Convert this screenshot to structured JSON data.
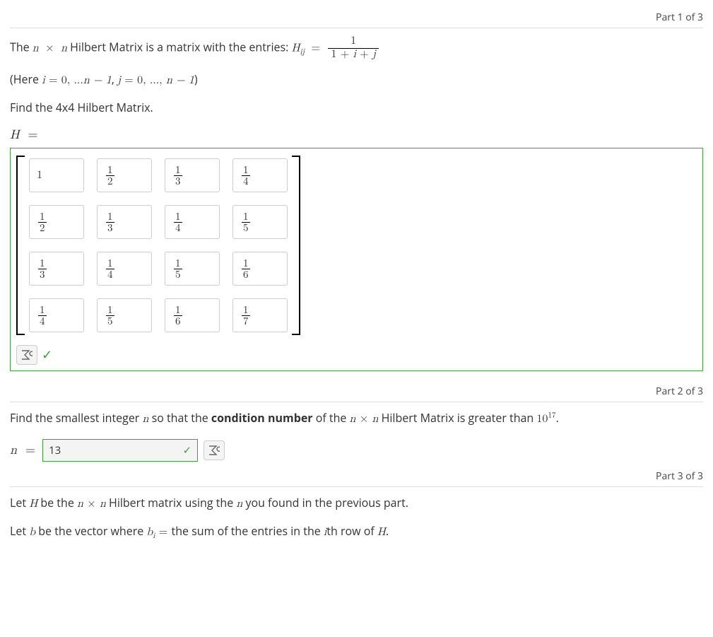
{
  "parts": {
    "p1_label": "Part 1 of 3",
    "p2_label": "Part 2 of 3",
    "p3_label": "Part 3 of 3"
  },
  "part1": {
    "intro_pre": "The ",
    "intro_mid": " Hilbert Matrix is a matrix with the entries: ",
    "dim_n": "n",
    "times": "×",
    "Hij": "H",
    "Hij_sub": "ij",
    "eq": "=",
    "frac_num": "1",
    "frac_den_prefix": "1 + ",
    "frac_den_i": "i",
    "frac_den_plus": " + ",
    "frac_den_j": "j",
    "range_open": "(Here ",
    "range_i": "i",
    "range_eq": " = 0, ...",
    "range_nm1": "n − 1",
    "range_comma": ",  ",
    "range_j": "j",
    "range_jeq": " = 0, ..., ",
    "range_close": ")",
    "find_text": "Find the 4x4 Hilbert Matrix.",
    "Hlabel": "H",
    "Heq": "=",
    "matrix": [
      [
        "1",
        "1/2",
        "1/3",
        "1/4"
      ],
      [
        "1/2",
        "1/3",
        "1/4",
        "1/5"
      ],
      [
        "1/3",
        "1/4",
        "1/5",
        "1/6"
      ],
      [
        "1/4",
        "1/5",
        "1/6",
        "1/7"
      ]
    ]
  },
  "part2": {
    "text_pre": "Find the smallest integer ",
    "text_n": "n",
    "text_mid": " so that the ",
    "text_bold": "condition number",
    "text_mid2": " of the ",
    "text_dim_n1": "n",
    "text_times": "×",
    "text_dim_n2": "n",
    "text_post": " Hilbert Matrix is greater than ",
    "ten": "10",
    "exp": "17",
    "period": ".",
    "n_label": "n",
    "n_eq": "=",
    "n_value": "13"
  },
  "part3": {
    "line1_pre": "Let ",
    "line1_H": "H",
    "line1_mid": " be the ",
    "line1_n1": "n",
    "line1_times": "×",
    "line1_n2": "n",
    "line1_mid2": " Hilbert matrix using the ",
    "line1_nref": "n",
    "line1_post": " you found in the previous part.",
    "line2_pre": "Let ",
    "line2_b": "b",
    "line2_mid": " be the vector where ",
    "line2_bi": "b",
    "line2_sub": "i",
    "line2_eq": " = ",
    "line2_post_pre": " the sum of the entries in the ",
    "line2_i": "i",
    "line2_post": "th row of ",
    "line2_H": "H",
    "line2_period": "."
  },
  "icons": {
    "pref": "⚙",
    "check": "✓"
  }
}
